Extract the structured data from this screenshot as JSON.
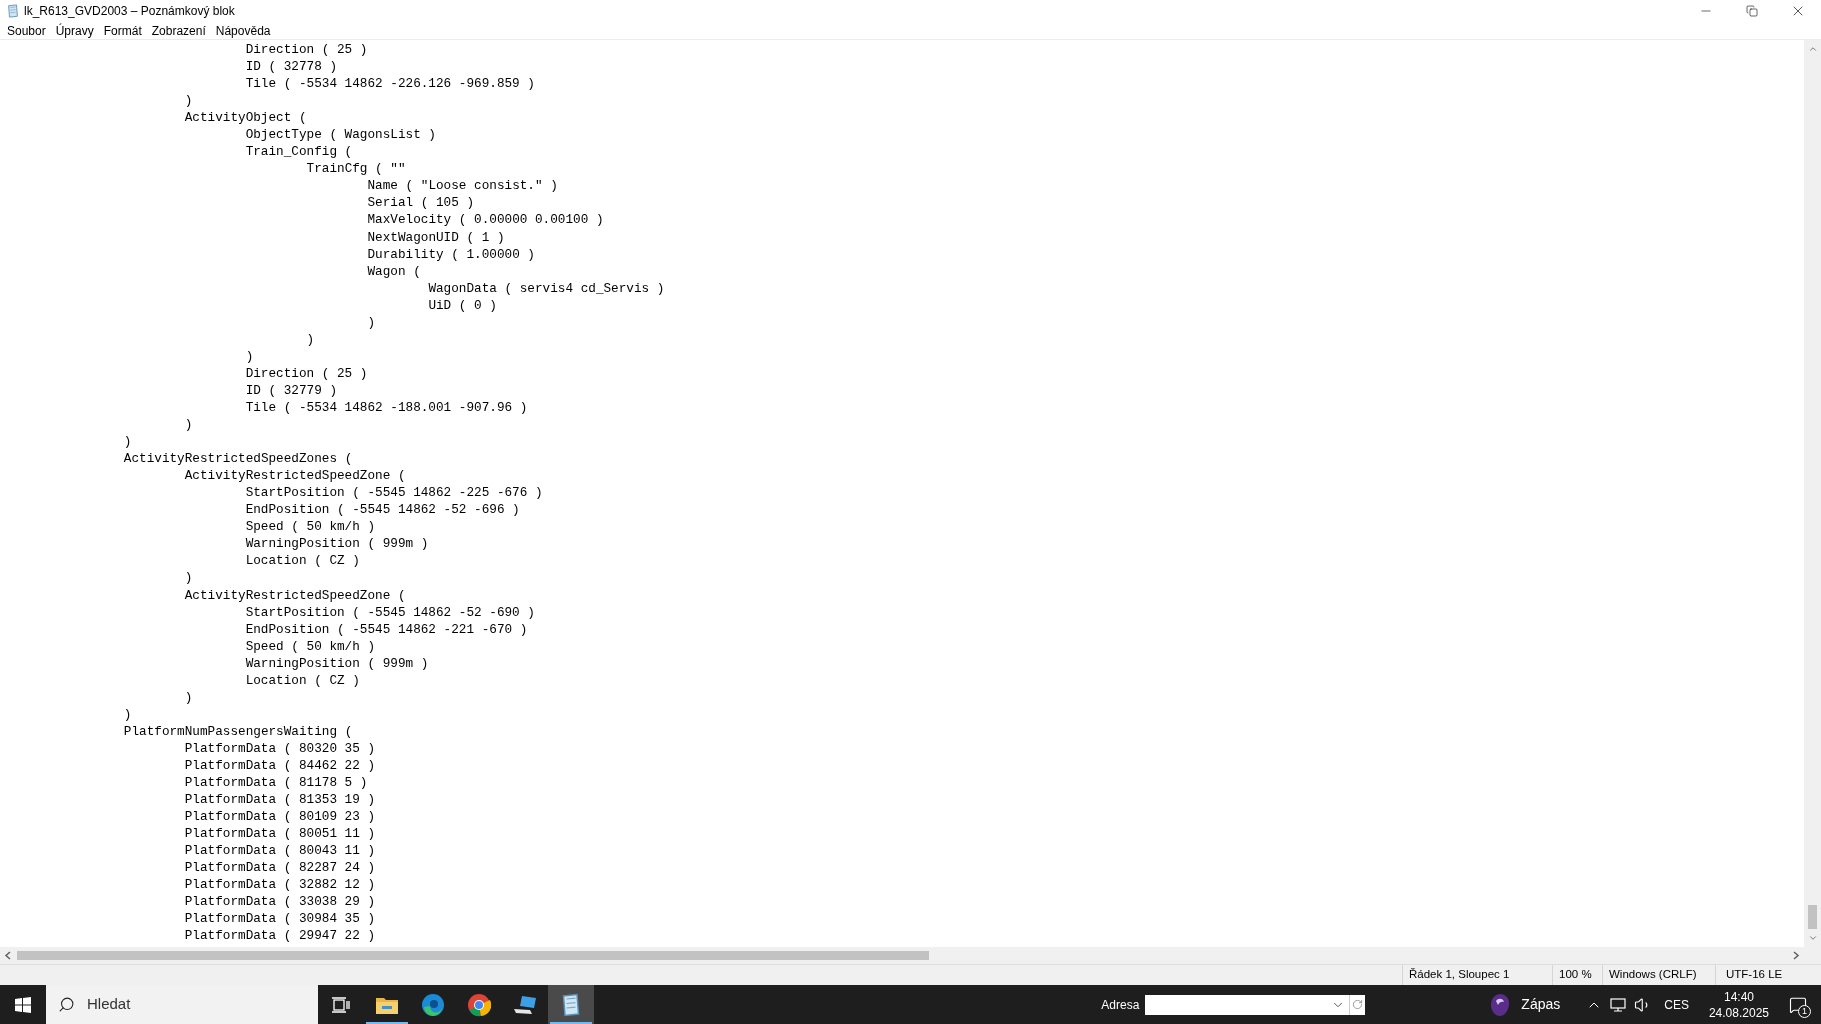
{
  "window": {
    "title": "lk_R613_GVD2003 – Poznámkový blok"
  },
  "menu": [
    "Soubor",
    "Úpravy",
    "Formát",
    "Zobrazení",
    "Nápověda"
  ],
  "document": {
    "lines": [
      "\t\t\t\tDirection ( 25 )",
      "\t\t\t\tID ( 32778 )",
      "\t\t\t\tTile ( -5534 14862 -226.126 -969.859 )",
      "\t\t\t)",
      "\t\t\tActivityObject (",
      "\t\t\t\tObjectType ( WagonsList )",
      "\t\t\t\tTrain_Config (",
      "\t\t\t\t\tTrainCfg ( \"\"",
      "\t\t\t\t\t\tName ( \"Loose consist.\" )",
      "\t\t\t\t\t\tSerial ( 105 )",
      "\t\t\t\t\t\tMaxVelocity ( 0.00000 0.00100 )",
      "\t\t\t\t\t\tNextWagonUID ( 1 )",
      "\t\t\t\t\t\tDurability ( 1.00000 )",
      "\t\t\t\t\t\tWagon (",
      "\t\t\t\t\t\t\tWagonData ( servis4 cd_Servis )",
      "\t\t\t\t\t\t\tUiD ( 0 )",
      "\t\t\t\t\t\t)",
      "\t\t\t\t\t)",
      "\t\t\t\t)",
      "\t\t\t\tDirection ( 25 )",
      "\t\t\t\tID ( 32779 )",
      "\t\t\t\tTile ( -5534 14862 -188.001 -907.96 )",
      "\t\t\t)",
      "\t\t)",
      "\t\tActivityRestrictedSpeedZones (",
      "\t\t\tActivityRestrictedSpeedZone (",
      "\t\t\t\tStartPosition ( -5545 14862 -225 -676 )",
      "\t\t\t\tEndPosition ( -5545 14862 -52 -696 )",
      "\t\t\t\tSpeed ( 50 km/h )",
      "\t\t\t\tWarningPosition ( 999m )",
      "\t\t\t\tLocation ( CZ )",
      "\t\t\t)",
      "\t\t\tActivityRestrictedSpeedZone (",
      "\t\t\t\tStartPosition ( -5545 14862 -52 -690 )",
      "\t\t\t\tEndPosition ( -5545 14862 -221 -670 )",
      "\t\t\t\tSpeed ( 50 km/h )",
      "\t\t\t\tWarningPosition ( 999m )",
      "\t\t\t\tLocation ( CZ )",
      "\t\t\t)",
      "\t\t)",
      "\t\tPlatformNumPassengersWaiting (",
      "\t\t\tPlatformData ( 80320 35 )",
      "\t\t\tPlatformData ( 84462 22 )",
      "\t\t\tPlatformData ( 81178 5 )",
      "\t\t\tPlatformData ( 81353 19 )",
      "\t\t\tPlatformData ( 80109 23 )",
      "\t\t\tPlatformData ( 80051 11 )",
      "\t\t\tPlatformData ( 80043 11 )",
      "\t\t\tPlatformData ( 82287 24 )",
      "\t\t\tPlatformData ( 32882 12 )",
      "\t\t\tPlatformData ( 33038 29 )",
      "\t\t\tPlatformData ( 30984 35 )",
      "\t\t\tPlatformData ( 29947 22 )"
    ]
  },
  "status_bar": {
    "position": "Řádek 1, Sloupec 1",
    "zoom": "100 %",
    "line_ending": "Windows (CRLF)",
    "encoding": "UTF-16 LE"
  },
  "taskbar": {
    "search_placeholder": "Hledat",
    "apps": [
      {
        "kind": "folder",
        "running": true,
        "selected": false
      },
      {
        "kind": "edge",
        "running": false,
        "selected": false
      },
      {
        "kind": "chrome",
        "running": false,
        "selected": false
      },
      {
        "kind": "computer",
        "running": false,
        "selected": false
      },
      {
        "kind": "notepad",
        "running": true,
        "selected": true
      }
    ],
    "address_label": "Adresa",
    "widget": "Zápas",
    "language": "CES",
    "time": "14:40",
    "date": "24.08.2025",
    "notifications": "1"
  }
}
